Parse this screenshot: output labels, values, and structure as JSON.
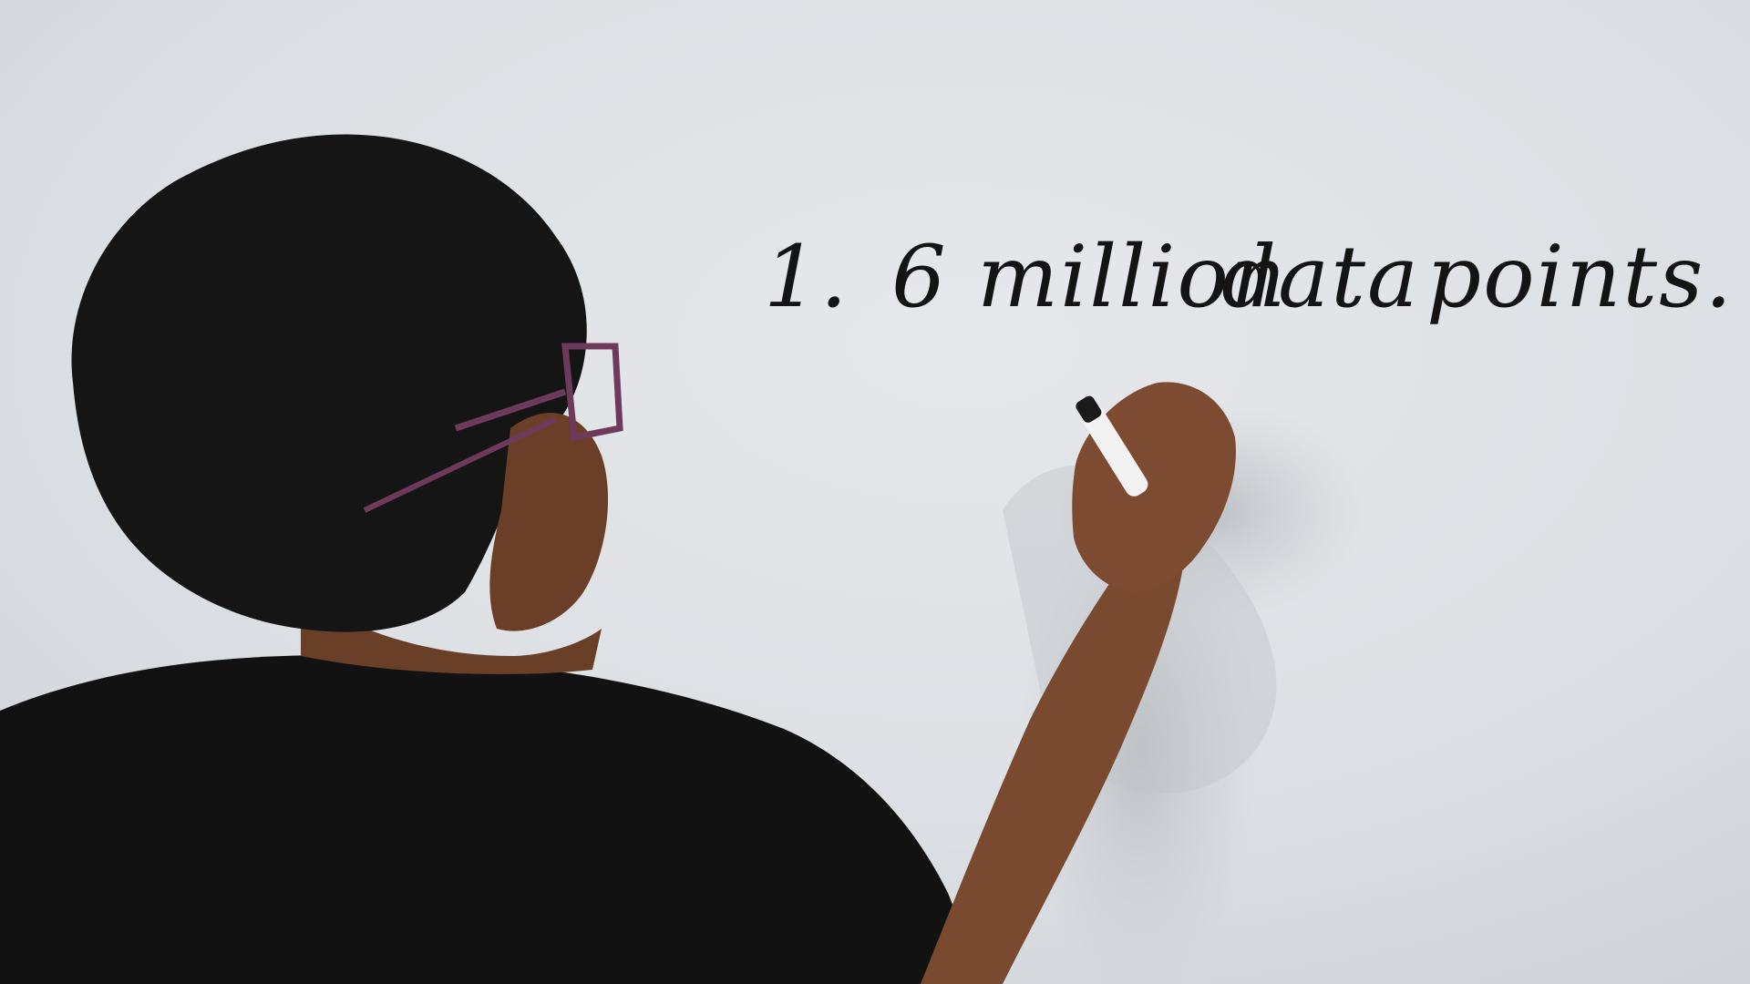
{
  "board": {
    "item_number": "1.",
    "count": "6",
    "word1": "million",
    "word2": "data",
    "word3": "points."
  },
  "colors": {
    "whiteboard": "#dcdfe3",
    "ink": "#141414",
    "hair": "#151515",
    "skin": "#7a4a30",
    "shirt": "#121212",
    "glasses_frame": "#6e3a5c",
    "marker_body": "#f2f2f2",
    "marker_cap": "#1a1a1a"
  },
  "icons": {
    "marker": "whiteboard-marker-icon"
  }
}
